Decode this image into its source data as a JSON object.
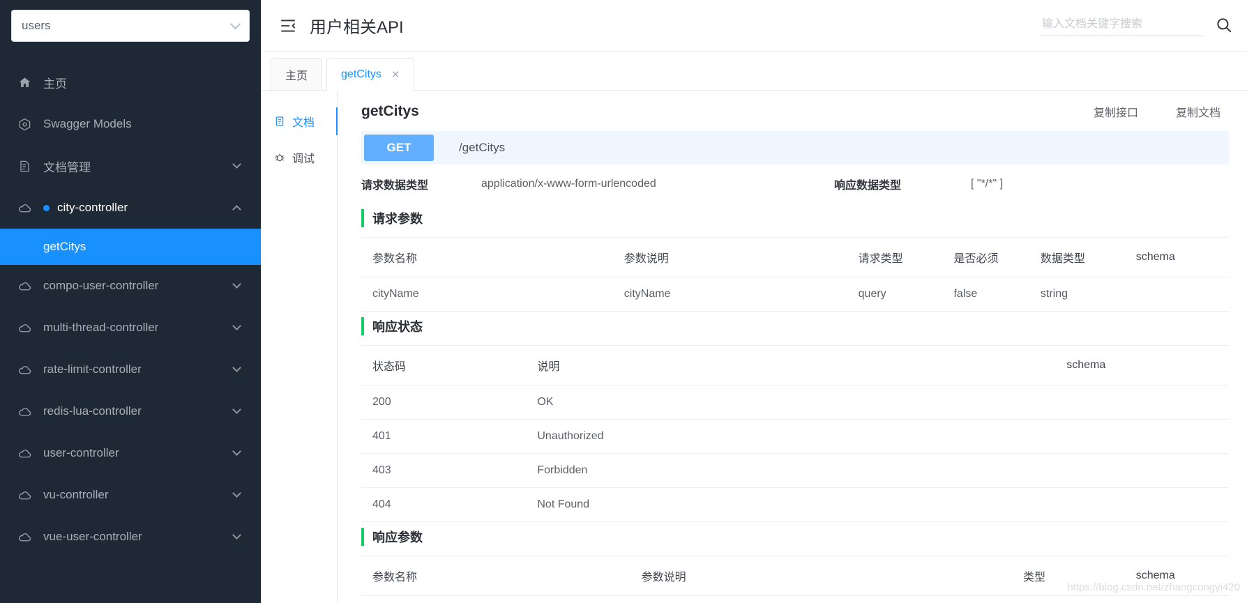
{
  "sidebar": {
    "project_select": {
      "value": "users",
      "placeholder": "users",
      "chevron": "chevron-down-icon"
    },
    "items": [
      {
        "label": "主页",
        "icon": "home-icon",
        "type": "plain"
      },
      {
        "label": "Swagger Models",
        "icon": "model-icon",
        "type": "plain"
      },
      {
        "label": "文档管理",
        "icon": "doc-manage-icon",
        "type": "expandable"
      },
      {
        "label": "city-controller",
        "icon": "cloud-icon",
        "type": "expandable",
        "active": true,
        "dot": true
      },
      {
        "label": "compo-user-controller",
        "icon": "cloud-icon",
        "type": "expandable"
      },
      {
        "label": "multi-thread-controller",
        "icon": "cloud-icon",
        "type": "expandable"
      },
      {
        "label": "rate-limit-controller",
        "icon": "cloud-icon",
        "type": "expandable"
      },
      {
        "label": "redis-lua-controller",
        "icon": "cloud-icon",
        "type": "expandable"
      },
      {
        "label": "user-controller",
        "icon": "cloud-icon",
        "type": "expandable"
      },
      {
        "label": "vu-controller",
        "icon": "cloud-icon",
        "type": "expandable"
      },
      {
        "label": "vue-user-controller",
        "icon": "cloud-icon",
        "type": "expandable"
      }
    ],
    "submenu": {
      "label": "getCitys",
      "active": true
    }
  },
  "header": {
    "collapse_icon": "menu-collapse-icon",
    "title": "用户相关API",
    "search": {
      "placeholder": "输入文档关键字搜索",
      "value": "",
      "icon": "search-icon"
    }
  },
  "tabs": [
    {
      "label": "主页",
      "active": false,
      "closable": false
    },
    {
      "label": "getCitys",
      "active": true,
      "closable": true,
      "close_glyph": "✕"
    }
  ],
  "vtabs": [
    {
      "label": "文档",
      "icon": "document-icon",
      "active": true
    },
    {
      "label": "调试",
      "icon": "debug-bug-icon",
      "active": false
    }
  ],
  "api": {
    "name": "getCitys",
    "actions": [
      {
        "label": "复制接口"
      },
      {
        "label": "复制文档"
      }
    ],
    "method": "GET",
    "path": "/getCitys",
    "meta": {
      "request_type_label": "请求数据类型",
      "request_type_value": "application/x-www-form-urlencoded",
      "response_type_label": "响应数据类型",
      "response_type_value": "[ \"*/*\" ]"
    },
    "request_params": {
      "title": "请求参数",
      "headers": [
        "参数名称",
        "参数说明",
        "请求类型",
        "是否必须",
        "数据类型",
        "schema"
      ],
      "rows": [
        {
          "name": "cityName",
          "desc": "cityName",
          "in": "query",
          "required": "false",
          "type": "string",
          "schema": ""
        }
      ]
    },
    "response_status": {
      "title": "响应状态",
      "headers": [
        "状态码",
        "说明",
        "schema"
      ],
      "rows": [
        {
          "code": "200",
          "desc": "OK",
          "schema": ""
        },
        {
          "code": "401",
          "desc": "Unauthorized",
          "schema": ""
        },
        {
          "code": "403",
          "desc": "Forbidden",
          "schema": ""
        },
        {
          "code": "404",
          "desc": "Not Found",
          "schema": ""
        }
      ]
    },
    "response_params": {
      "title": "响应参数",
      "headers": [
        "参数名称",
        "参数说明",
        "类型",
        "schema"
      ]
    }
  },
  "watermark": "https://blog.csdn.net/zhangcongyi420",
  "colors": {
    "sidebar_bg": "#1f2935",
    "accent": "#1890ff",
    "method_get": "#61affe",
    "section_bar": "#13ce66",
    "url_bar_bg": "#eff6fe"
  }
}
